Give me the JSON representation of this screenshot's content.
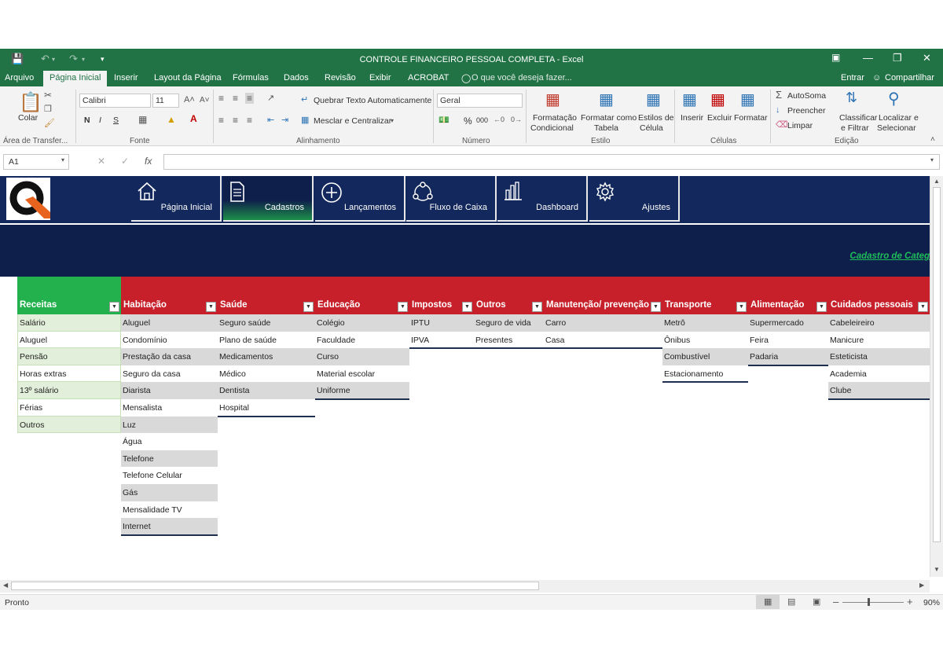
{
  "window": {
    "title": "CONTROLE FINANCEIRO PESSOAL COMPLETA - Excel",
    "entrar": "Entrar",
    "compartilhar": "Compartilhar"
  },
  "tabs": [
    "Arquivo",
    "Página Inicial",
    "Inserir",
    "Layout da Página",
    "Fórmulas",
    "Dados",
    "Revisão",
    "Exibir",
    "ACROBAT"
  ],
  "tell_me": "O que você deseja fazer...",
  "ribbon": {
    "colar": "Colar",
    "area_transfer": "Área de Transfer...",
    "font_name": "Calibri",
    "font_size": "11",
    "font_group": "Fonte",
    "bold": "N",
    "italic": "I",
    "underline": "S",
    "wrap_text": "Quebrar Texto Automaticamente",
    "merge_center": "Mesclar e Centralizar",
    "align_group": "Alinhamento",
    "number_format": "Geral",
    "percent": "%",
    "thousands": "000",
    "number_group": "Número",
    "cond_format_1": "Formatação",
    "cond_format_2": "Condicional",
    "format_table_1": "Formatar como",
    "format_table_2": "Tabela",
    "cell_styles_1": "Estilos de",
    "cell_styles_2": "Célula",
    "style_group": "Estilo",
    "insert": "Inserir",
    "delete": "Excluir",
    "format": "Formatar",
    "cells_group": "Células",
    "autosum": "AutoSoma",
    "fill": "Preencher",
    "clear": "Limpar",
    "sort_1": "Classificar",
    "sort_2": "e Filtrar",
    "find_1": "Localizar e",
    "find_2": "Selecionar",
    "edit_group": "Edição"
  },
  "formula_bar": {
    "name_box": "A1",
    "fx": "fx",
    "value": ""
  },
  "nav": [
    {
      "label": "Página Inicial",
      "icon": "home-icon"
    },
    {
      "label": "Cadastros",
      "icon": "document-icon"
    },
    {
      "label": "Lançamentos",
      "icon": "plus-circle-icon"
    },
    {
      "label": "Fluxo de Caixa",
      "icon": "flow-icon"
    },
    {
      "label": "Dashboard",
      "icon": "bar-chart-icon"
    },
    {
      "label": "Ajustes",
      "icon": "gear-icon"
    }
  ],
  "cadastro_link": "Cadastro de Categ",
  "columns": [
    {
      "header": "Receitas",
      "items": [
        "Salário",
        "Aluguel",
        "Pensão",
        "Horas extras",
        "13º salário",
        "Férias",
        "Outros"
      ]
    },
    {
      "header": "Habitação",
      "items": [
        "Aluguel",
        "Condomínio",
        "Prestação da casa",
        "Seguro da casa",
        "Diarista",
        "Mensalista",
        "Luz",
        "Água",
        "Telefone",
        "Telefone Celular",
        "Gás",
        "Mensalidade TV",
        "Internet"
      ]
    },
    {
      "header": "Saúde",
      "items": [
        "Seguro saúde",
        "Plano de saúde",
        "Medicamentos",
        "Médico",
        "Dentista",
        "Hospital"
      ]
    },
    {
      "header": "Educação",
      "items": [
        "Colégio",
        "Faculdade",
        "Curso",
        "Material escolar",
        "Uniforme"
      ]
    },
    {
      "header": "Impostos",
      "items": [
        "IPTU",
        "IPVA"
      ]
    },
    {
      "header": "Outros",
      "items": [
        "Seguro de vida",
        "Presentes"
      ]
    },
    {
      "header": "Manutenção/ prevenção",
      "items": [
        "Carro",
        "Casa"
      ]
    },
    {
      "header": "Transporte",
      "items": [
        "Metrô",
        "Ônibus",
        "Combustível",
        "Estacionamento"
      ]
    },
    {
      "header": "Alimentação",
      "items": [
        "Supermercado",
        "Feira",
        "Padaria"
      ]
    },
    {
      "header": "Cuidados pessoais",
      "items": [
        "Cabeleireiro",
        "Manicure",
        "Esteticista",
        "Academia",
        "Clube"
      ]
    }
  ],
  "status": {
    "ready": "Pronto",
    "zoom": "90%"
  },
  "colors": {
    "excel_green": "#217346",
    "nav_blue": "#13285c",
    "header_red": "#c7202a",
    "header_green": "#23b14d"
  }
}
